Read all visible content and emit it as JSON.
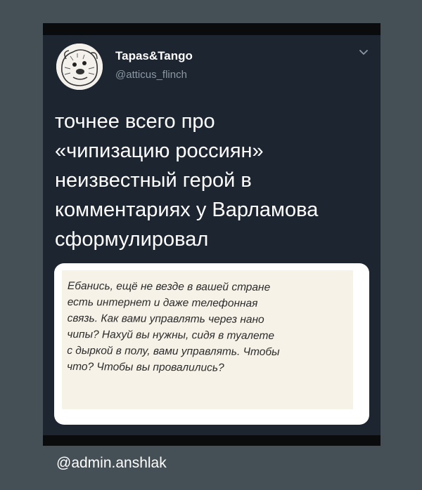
{
  "post": {
    "display_name": "Tapas&Tango",
    "handle": "@atticus_flinch",
    "text": "точнее всего про\n«чипизацию россиян»\nнеизвестный герой в\nкомментариях у Варламова\nсформулировал"
  },
  "quote": {
    "text": "Ебанись, ещё не везде в вашей стране\nесть интернет и даже телефонная\nсвязь. Как вами управлять через нано\nчипы? Нахуй вы нужны, сидя в туалете\nс дыркой в полу, вами управлять. Чтобы\nчто? Чтобы вы провалились?"
  },
  "watermark": "@admin.anshlak",
  "icons": {
    "avatar": "cartoon-dog-avatar",
    "menu": "chevron-down-icon"
  },
  "colors": {
    "card_bg": "#1c2530",
    "page_bg": "#454f56",
    "handle": "#8b98a5"
  }
}
